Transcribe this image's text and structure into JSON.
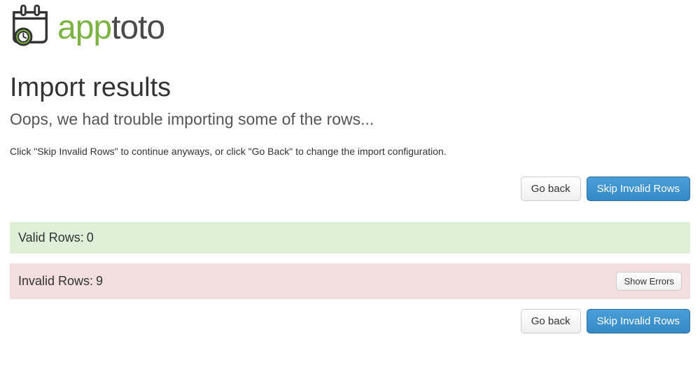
{
  "logo": {
    "brand_part1": "app",
    "brand_part2": "toto"
  },
  "header": {
    "title": "Import results",
    "subtitle": "Oops, we had trouble importing some of the rows...",
    "instructions": "Click \"Skip Invalid Rows\" to continue anyways, or click \"Go Back\" to change the import configuration."
  },
  "actions": {
    "go_back_label": "Go back",
    "skip_invalid_label": "Skip Invalid Rows",
    "show_errors_label": "Show Errors"
  },
  "results": {
    "valid_label": "Valid Rows:",
    "valid_count": "0",
    "invalid_label": "Invalid Rows:",
    "invalid_count": "9"
  }
}
